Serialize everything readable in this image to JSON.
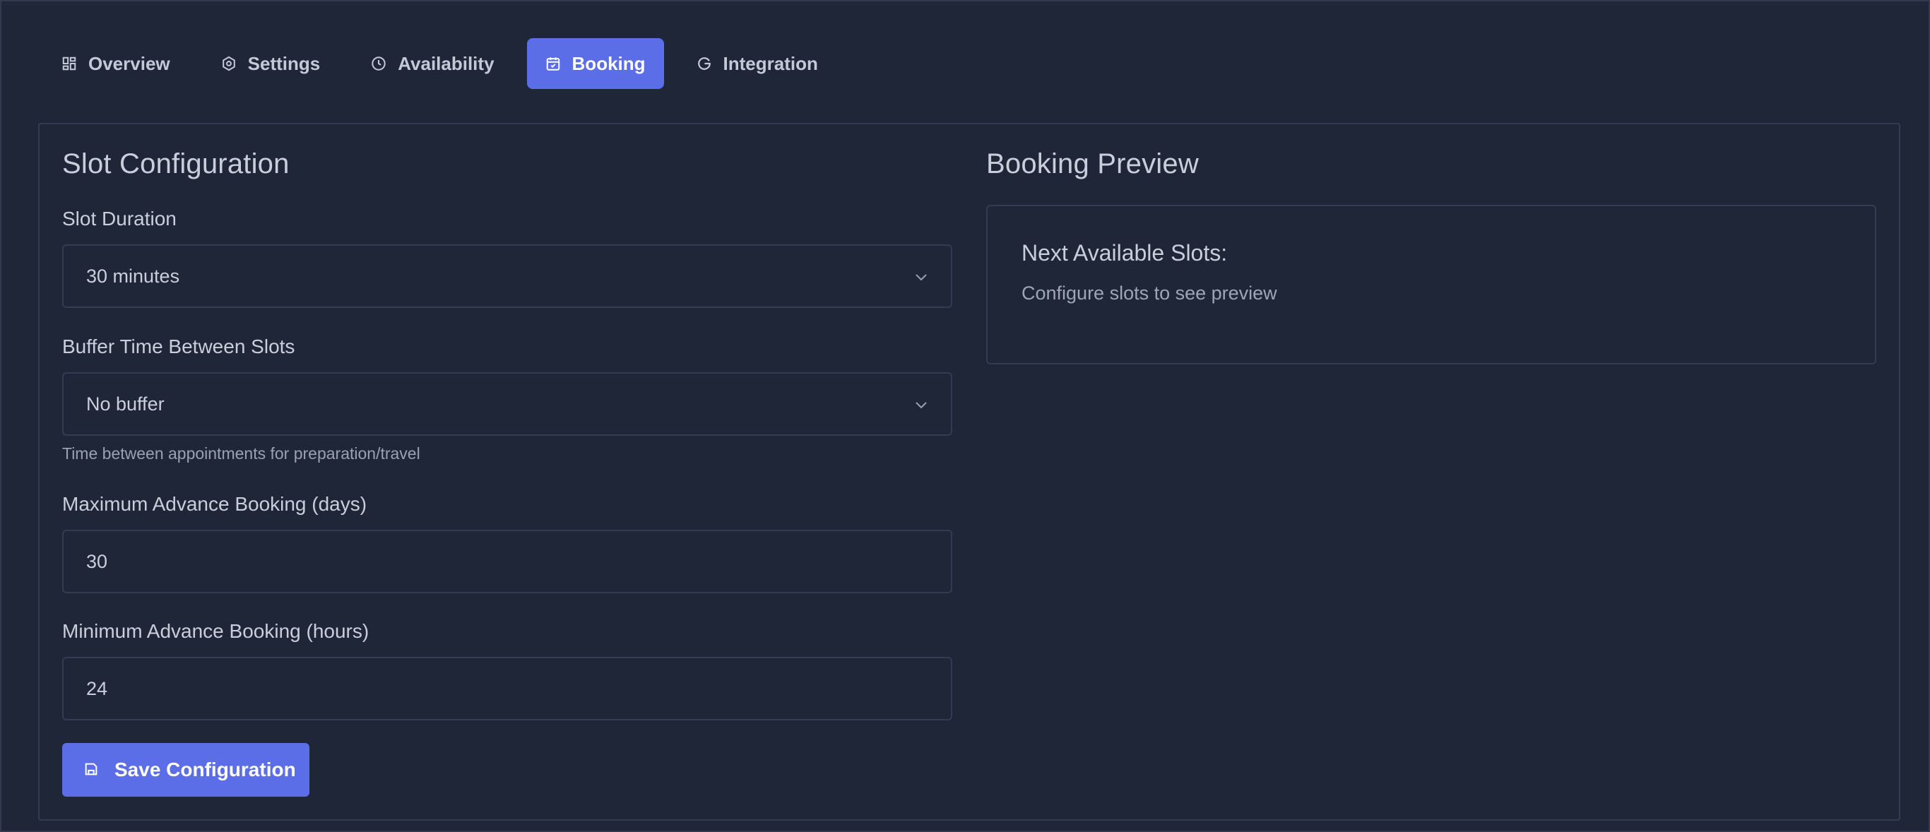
{
  "tabs": [
    {
      "label": "Overview",
      "icon": "grid-icon",
      "active": false
    },
    {
      "label": "Settings",
      "icon": "hexagon-gear-icon",
      "active": false
    },
    {
      "label": "Availability",
      "icon": "clock-icon",
      "active": false
    },
    {
      "label": "Booking",
      "icon": "calendar-icon",
      "active": true
    },
    {
      "label": "Integration",
      "icon": "google-icon",
      "active": false
    }
  ],
  "slot_config": {
    "title": "Slot Configuration",
    "slot_duration": {
      "label": "Slot Duration",
      "value": "30 minutes"
    },
    "buffer_time": {
      "label": "Buffer Time Between Slots",
      "value": "No buffer",
      "helper": "Time between appointments for preparation/travel"
    },
    "max_advance": {
      "label": "Maximum Advance Booking (days)",
      "value": "30"
    },
    "min_advance": {
      "label": "Minimum Advance Booking (hours)",
      "value": "24"
    },
    "save_label": "Save Configuration"
  },
  "preview": {
    "title": "Booking Preview",
    "next_slots_title": "Next Available Slots:",
    "placeholder": "Configure slots to see preview"
  },
  "colors": {
    "background": "#1f2638",
    "accent": "#5b6ee8",
    "border": "#343c50"
  }
}
